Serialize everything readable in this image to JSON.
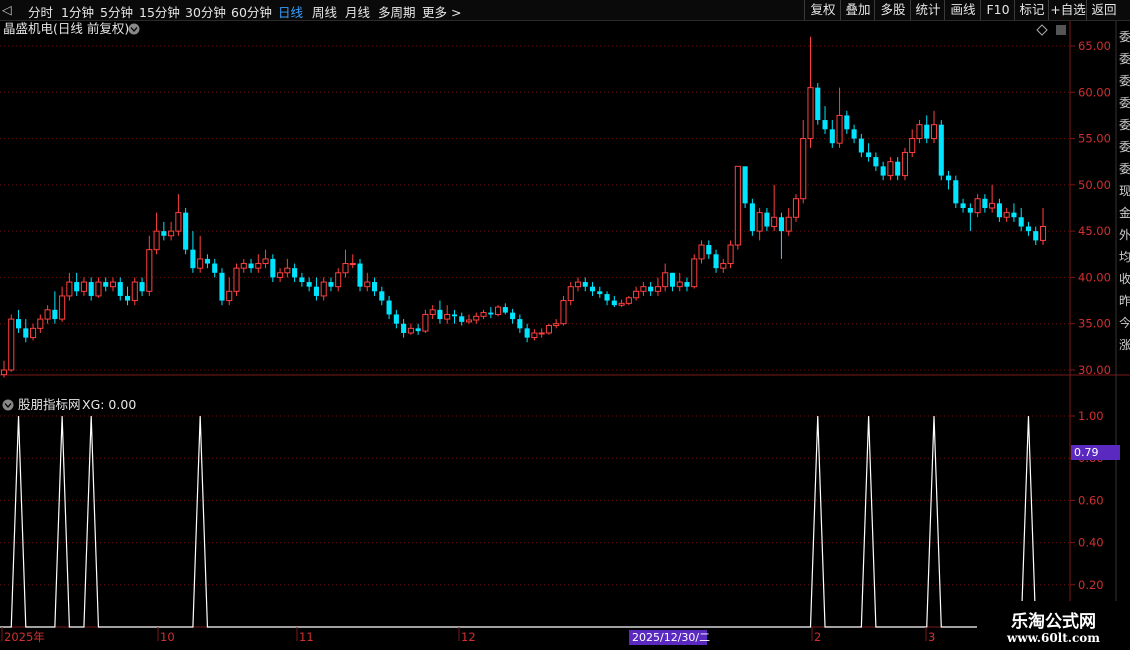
{
  "toolbar": {
    "periods": [
      "分时",
      "1分钟",
      "5分钟",
      "15分钟",
      "30分钟",
      "60分钟",
      "日线",
      "周线",
      "月线",
      "多周期",
      "更多 >"
    ],
    "active_period": "日线",
    "right_buttons": [
      "复权",
      "叠加",
      "多股",
      "统计",
      "画线",
      "F10",
      "标记",
      "+自选",
      "返回"
    ]
  },
  "main_panel": {
    "title": "晶盛机电(日线 前复权)",
    "up_color": "#ff4040",
    "down_color": "#00e5ff"
  },
  "indicator_panel": {
    "title": "股朋指标网",
    "xg_label": "XG: 0.00",
    "current_value": "0.79",
    "y_labels": [
      "1.00",
      "0.80",
      "0.60",
      "0.40",
      "0.20"
    ]
  },
  "time_axis": {
    "labels": [
      "2025年",
      "10",
      "11",
      "12",
      "2",
      "3"
    ],
    "cursor_date": "2025/12/30/二"
  },
  "side_strip_glyphs": [
    "委",
    "委",
    "委",
    "委",
    "委",
    "委",
    "委",
    "现",
    "金",
    "外",
    "均",
    "收",
    "昨",
    "今",
    "涨"
  ],
  "watermark": {
    "line1": "乐淘公式网",
    "line2": "www.60lt.com"
  },
  "chart_data": [
    {
      "type": "candlestick",
      "title": "晶盛机电(日线 前复权)",
      "y_ticks": [
        65,
        60,
        55,
        50,
        45,
        40,
        35,
        30
      ],
      "ylim": [
        28,
        67
      ],
      "x_labels": [
        "2025年",
        "10",
        "11",
        "12",
        "2",
        "3"
      ],
      "candles": [
        [
          29.5,
          30.0,
          29.2,
          31.0
        ],
        [
          30.0,
          35.5,
          29.8,
          36.0
        ],
        [
          35.5,
          34.5,
          34.0,
          36.5
        ],
        [
          34.5,
          33.5,
          33.0,
          35.5
        ],
        [
          33.5,
          34.5,
          33.2,
          35.0
        ],
        [
          34.5,
          35.5,
          34.0,
          36.0
        ],
        [
          35.5,
          36.5,
          35.0,
          37.0
        ],
        [
          36.5,
          35.5,
          35.0,
          38.5
        ],
        [
          35.5,
          38.0,
          35.2,
          39.0
        ],
        [
          38.0,
          39.5,
          37.5,
          40.5
        ],
        [
          39.5,
          38.5,
          38.0,
          40.5
        ],
        [
          38.5,
          39.5,
          38.0,
          40.0
        ],
        [
          39.5,
          38.0,
          37.5,
          40.0
        ],
        [
          38.0,
          39.5,
          37.8,
          40.0
        ],
        [
          39.5,
          39.0,
          38.5,
          40.0
        ],
        [
          39.0,
          39.5,
          38.5,
          40.0
        ],
        [
          39.5,
          38.0,
          37.5,
          40.0
        ],
        [
          38.0,
          37.5,
          37.0,
          39.0
        ],
        [
          37.5,
          39.5,
          37.0,
          40.0
        ],
        [
          39.5,
          38.5,
          38.0,
          40.0
        ],
        [
          38.5,
          43.0,
          38.0,
          44.5
        ],
        [
          43.0,
          45.0,
          42.5,
          47.0
        ],
        [
          45.0,
          44.5,
          44.0,
          46.0
        ],
        [
          44.5,
          45.0,
          44.0,
          46.0
        ],
        [
          45.0,
          47.0,
          44.5,
          49.0
        ],
        [
          47.0,
          43.0,
          42.5,
          47.5
        ],
        [
          43.0,
          41.0,
          40.5,
          45.0
        ],
        [
          41.0,
          42.0,
          40.5,
          44.5
        ],
        [
          42.0,
          41.5,
          41.0,
          42.5
        ],
        [
          41.5,
          40.5,
          40.0,
          42.0
        ],
        [
          40.5,
          37.5,
          37.0,
          41.0
        ],
        [
          37.5,
          38.5,
          37.0,
          40.0
        ],
        [
          38.5,
          41.0,
          38.0,
          41.5
        ],
        [
          41.0,
          41.5,
          40.5,
          42.0
        ],
        [
          41.5,
          41.0,
          40.5,
          42.0
        ],
        [
          41.0,
          41.5,
          40.5,
          42.5
        ],
        [
          41.5,
          42.0,
          41.0,
          43.0
        ],
        [
          42.0,
          40.0,
          39.5,
          42.5
        ],
        [
          40.0,
          40.5,
          39.5,
          41.0
        ],
        [
          40.5,
          41.0,
          40.0,
          42.0
        ],
        [
          41.0,
          40.0,
          39.5,
          41.5
        ],
        [
          40.0,
          39.5,
          39.0,
          40.5
        ],
        [
          39.5,
          39.0,
          38.5,
          40.0
        ],
        [
          39.0,
          38.0,
          37.5,
          40.0
        ],
        [
          38.0,
          39.5,
          37.5,
          40.0
        ],
        [
          39.5,
          39.0,
          38.5,
          40.0
        ],
        [
          39.0,
          40.5,
          38.5,
          41.0
        ],
        [
          40.5,
          41.5,
          40.0,
          43.0
        ],
        [
          41.5,
          41.5,
          41.0,
          42.5
        ],
        [
          41.5,
          39.0,
          38.5,
          42.0
        ],
        [
          39.0,
          39.5,
          38.5,
          40.5
        ],
        [
          39.5,
          38.5,
          38.0,
          40.0
        ],
        [
          38.5,
          37.5,
          37.0,
          39.0
        ],
        [
          37.5,
          36.0,
          35.5,
          38.0
        ],
        [
          36.0,
          35.0,
          34.5,
          36.5
        ],
        [
          35.0,
          34.0,
          33.5,
          35.5
        ],
        [
          34.0,
          34.5,
          33.8,
          35.0
        ],
        [
          34.5,
          34.2,
          33.8,
          35.0
        ],
        [
          34.2,
          36.0,
          34.0,
          36.5
        ],
        [
          36.0,
          36.5,
          35.5,
          37.0
        ],
        [
          36.5,
          35.5,
          35.0,
          37.5
        ],
        [
          35.5,
          36.0,
          35.0,
          37.0
        ],
        [
          36.0,
          35.8,
          35.0,
          36.5
        ],
        [
          35.8,
          35.2,
          34.8,
          36.2
        ],
        [
          35.2,
          35.4,
          35.0,
          36.0
        ],
        [
          35.4,
          35.8,
          35.0,
          36.2
        ],
        [
          35.8,
          36.2,
          35.5,
          36.5
        ],
        [
          36.2,
          36.0,
          35.6,
          36.8
        ],
        [
          36.0,
          36.8,
          35.8,
          37.0
        ],
        [
          36.8,
          36.2,
          36.0,
          37.2
        ],
        [
          36.2,
          35.5,
          35.0,
          36.6
        ],
        [
          35.5,
          34.5,
          34.0,
          36.0
        ],
        [
          34.5,
          33.5,
          33.0,
          35.0
        ],
        [
          33.5,
          34.0,
          33.2,
          34.4
        ],
        [
          34.0,
          34.0,
          33.5,
          34.5
        ],
        [
          34.0,
          34.8,
          33.8,
          35.0
        ],
        [
          34.8,
          35.0,
          34.5,
          35.5
        ],
        [
          35.0,
          37.5,
          34.8,
          38.0
        ],
        [
          37.5,
          39.0,
          37.0,
          39.5
        ],
        [
          39.0,
          39.5,
          38.5,
          40.0
        ],
        [
          39.5,
          39.0,
          38.5,
          40.0
        ],
        [
          39.0,
          38.5,
          38.0,
          39.5
        ],
        [
          38.5,
          38.2,
          37.8,
          39.0
        ],
        [
          38.2,
          37.5,
          37.0,
          38.5
        ],
        [
          37.5,
          37.0,
          36.8,
          38.0
        ],
        [
          37.0,
          37.2,
          36.8,
          37.6
        ],
        [
          37.2,
          37.8,
          37.0,
          38.0
        ],
        [
          37.8,
          38.5,
          37.5,
          39.0
        ],
        [
          38.5,
          39.0,
          38.0,
          39.5
        ],
        [
          39.0,
          38.5,
          38.0,
          39.5
        ],
        [
          38.5,
          39.0,
          38.0,
          40.0
        ],
        [
          39.0,
          40.5,
          38.5,
          41.5
        ],
        [
          40.5,
          39.0,
          38.5,
          40.5
        ],
        [
          39.0,
          39.5,
          38.5,
          40.5
        ],
        [
          39.5,
          39.0,
          38.5,
          40.0
        ],
        [
          39.0,
          42.0,
          38.8,
          42.5
        ],
        [
          42.0,
          43.5,
          41.5,
          44.0
        ],
        [
          43.5,
          42.5,
          42.0,
          44.0
        ],
        [
          42.5,
          41.0,
          40.5,
          43.0
        ],
        [
          41.0,
          41.5,
          40.5,
          42.0
        ],
        [
          41.5,
          43.5,
          41.0,
          44.0
        ],
        [
          43.5,
          52.0,
          43.0,
          52.0
        ],
        [
          52.0,
          48.0,
          47.5,
          52.0
        ],
        [
          48.0,
          45.0,
          44.5,
          48.5
        ],
        [
          45.0,
          47.0,
          44.0,
          47.5
        ],
        [
          47.0,
          45.5,
          45.0,
          47.5
        ],
        [
          45.5,
          46.5,
          45.0,
          50.0
        ],
        [
          46.5,
          45.0,
          42.0,
          47.0
        ],
        [
          45.0,
          46.5,
          44.5,
          47.5
        ],
        [
          46.5,
          48.5,
          46.0,
          49.0
        ],
        [
          48.5,
          55.0,
          48.0,
          57.0
        ],
        [
          55.0,
          60.5,
          54.0,
          66.0
        ],
        [
          60.5,
          57.0,
          56.5,
          61.0
        ],
        [
          57.0,
          56.0,
          55.5,
          58.5
        ],
        [
          56.0,
          54.5,
          54.0,
          57.0
        ],
        [
          54.5,
          57.5,
          54.0,
          60.5
        ],
        [
          57.5,
          56.0,
          55.5,
          58.0
        ],
        [
          56.0,
          55.0,
          54.5,
          56.5
        ],
        [
          55.0,
          53.5,
          53.0,
          55.5
        ],
        [
          53.5,
          53.0,
          52.5,
          54.5
        ],
        [
          53.0,
          52.0,
          51.5,
          53.5
        ],
        [
          52.0,
          51.0,
          50.5,
          52.5
        ],
        [
          51.0,
          52.5,
          50.5,
          53.0
        ],
        [
          52.5,
          51.0,
          50.5,
          53.0
        ],
        [
          51.0,
          53.5,
          50.5,
          54.0
        ],
        [
          53.5,
          55.0,
          53.0,
          56.0
        ],
        [
          55.0,
          56.5,
          54.5,
          57.0
        ],
        [
          56.5,
          55.0,
          54.5,
          57.5
        ],
        [
          55.0,
          56.5,
          54.5,
          58.0
        ],
        [
          56.5,
          51.0,
          50.5,
          57.0
        ],
        [
          51.0,
          50.5,
          49.5,
          51.5
        ],
        [
          50.5,
          48.0,
          47.5,
          51.0
        ],
        [
          48.0,
          47.5,
          47.0,
          48.5
        ],
        [
          47.5,
          47.0,
          45.0,
          48.0
        ],
        [
          47.0,
          48.5,
          46.5,
          49.0
        ],
        [
          48.5,
          47.5,
          47.0,
          49.0
        ],
        [
          47.5,
          48.0,
          47.0,
          50.0
        ],
        [
          48.0,
          46.5,
          46.0,
          48.5
        ],
        [
          46.5,
          47.0,
          46.0,
          47.5
        ],
        [
          47.0,
          46.5,
          46.0,
          48.0
        ],
        [
          46.5,
          45.5,
          45.0,
          47.5
        ],
        [
          45.5,
          45.0,
          44.5,
          46.0
        ],
        [
          45.0,
          44.0,
          43.5,
          45.5
        ],
        [
          44.0,
          45.5,
          43.5,
          47.5
        ]
      ]
    },
    {
      "type": "line",
      "title": "股朋指标网",
      "y_ticks": [
        1.0,
        0.8,
        0.6,
        0.4,
        0.2
      ],
      "ylim": [
        0,
        1.05
      ],
      "spikes_at_index": [
        2,
        8,
        12,
        27,
        112,
        119,
        128,
        141
      ],
      "values_note": "XG signal 0/1"
    }
  ]
}
